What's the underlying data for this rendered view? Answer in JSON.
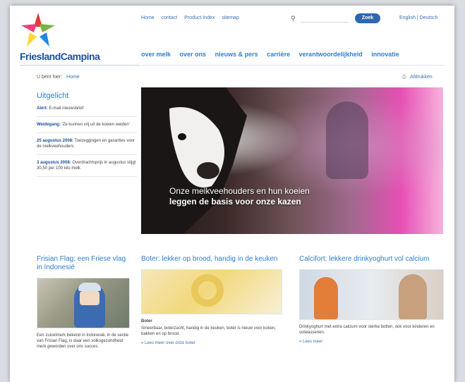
{
  "header": {
    "logo_text": "FrieslandCampina",
    "top_links": [
      "Home",
      "contact",
      "Product Index",
      "sitemap"
    ],
    "search_button": "Zoek",
    "language": "English | Deutsch",
    "main_nav": [
      "over melk",
      "over ons",
      "nieuws & pers",
      "carrière",
      "verantwoordelijkheid",
      "innovatie"
    ]
  },
  "breadcrumb": {
    "label": "U bent hier:",
    "home": "Home"
  },
  "share": {
    "label": "Afdrukken"
  },
  "sidebar": {
    "title": "Uitgelicht",
    "items": [
      {
        "title": "Alert:",
        "text": "E-mail nieuwsbrief"
      },
      {
        "title": "Weidegang:",
        "text": "'Ze kunnen vrij uit de koeien weiden'"
      },
      {
        "title": "25 augustus 2008:",
        "text": "Toezeggingen en garanties voor de melkveehouders"
      },
      {
        "title": "3 augustus 2008:",
        "text": "Overdrachtsprijs in augustus stijgt 30,50 per 100 kilo melk"
      }
    ]
  },
  "hero": {
    "caption_line1": "Onze melkveehouders en hun koeien",
    "caption_line2": "leggen de basis voor onze kazen"
  },
  "features": [
    {
      "title": "Frisian Flag: een Friese vlag in Indonesië",
      "text": "Een zuivelmerk bekend in Indonesië, in de sectie van Frisian Flag, is daar een volksgezondheid merk geworden over ons succes.",
      "more": ""
    },
    {
      "title": "Boter: lekker op brood, handig in de keuken",
      "label": "Boter",
      "text": "Smeerbaar, boterzacht, handig in de keuken, boter is nieuw voor koken, bakken en op brood.",
      "more": "» Lees meer over onze boter"
    },
    {
      "title": "Calcifort: lekkere drinkyoghurt vol calcium",
      "text": "Drinkyoghurt met extra calcium voor sterke botten, ook voor kinderen en volwassenen.",
      "more": "» Lees meer"
    }
  ],
  "colors": {
    "brand_blue": "#1b4fa0",
    "link_blue": "#2f7fd0",
    "button_blue": "#2f66ad",
    "hero_pink": "#e64fb4"
  }
}
